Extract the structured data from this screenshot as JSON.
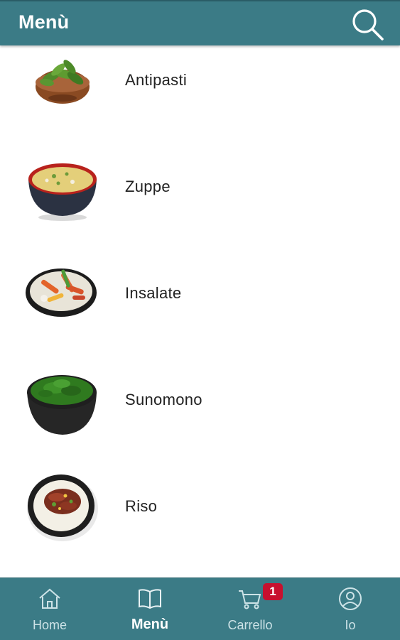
{
  "header": {
    "title": "Menù",
    "search_icon": "search-icon"
  },
  "menu": {
    "items": [
      {
        "label": "Antipasti",
        "image": "edamame-bowl"
      },
      {
        "label": "Zuppe",
        "image": "miso-soup-bowl"
      },
      {
        "label": "Insalate",
        "image": "salad-bowl"
      },
      {
        "label": "Sunomono",
        "image": "seaweed-bowl"
      },
      {
        "label": "Riso",
        "image": "rice-bowl"
      }
    ]
  },
  "nav": {
    "items": [
      {
        "label": "Home",
        "icon": "home-icon"
      },
      {
        "label": "Menù",
        "icon": "book-icon",
        "active": true
      },
      {
        "label": "Carrello",
        "icon": "cart-icon",
        "badge": "1"
      },
      {
        "label": "Io",
        "icon": "user-icon"
      }
    ]
  },
  "colors": {
    "accent": "#3b7b86",
    "badge": "#c8102e"
  }
}
